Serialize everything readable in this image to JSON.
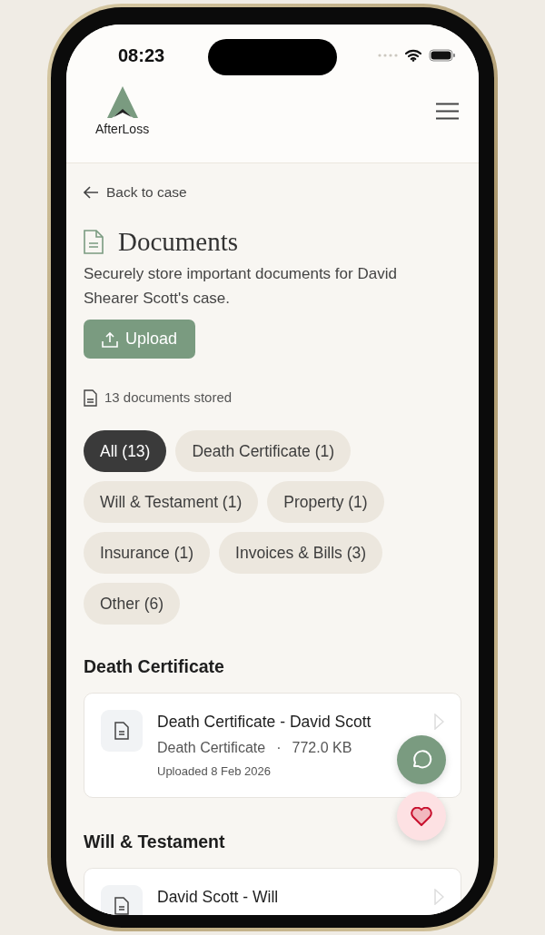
{
  "status_bar": {
    "time": "08:23"
  },
  "header": {
    "logo_text": "AfterLoss"
  },
  "back_link": "Back to case",
  "page": {
    "title": "Documents",
    "description": "Securely store important documents for David Shearer Scott's case.",
    "upload_button": "Upload",
    "count": "13 documents stored"
  },
  "filters": [
    {
      "label": "All (13)",
      "selected": true
    },
    {
      "label": "Death Certificate (1)",
      "selected": false
    },
    {
      "label": "Will & Testament (1)",
      "selected": false
    },
    {
      "label": "Property (1)",
      "selected": false
    },
    {
      "label": "Insurance (1)",
      "selected": false
    },
    {
      "label": "Invoices & Bills (3)",
      "selected": false
    },
    {
      "label": "Other (6)",
      "selected": false
    }
  ],
  "sections": [
    {
      "heading": "Death Certificate",
      "documents": [
        {
          "title": "Death Certificate - David Scott",
          "type": "Death Certificate",
          "separator": "·",
          "size": "772.0 KB",
          "uploaded": "Uploaded 8 Feb 2026"
        }
      ]
    },
    {
      "heading": "Will & Testament",
      "documents": [
        {
          "title": "David Scott - Will"
        }
      ]
    }
  ]
}
